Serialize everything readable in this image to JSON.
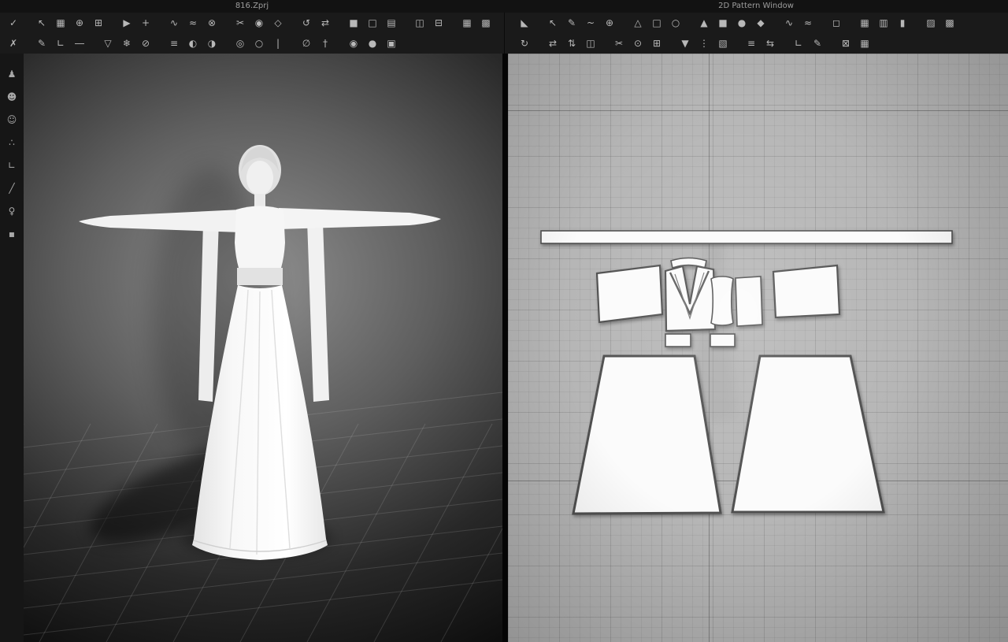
{
  "titlebar": {
    "left_title": "816.Zprj",
    "right_title": "2D Pattern Window"
  },
  "colors": {
    "titlebar_bg": "#121212",
    "toolbar_bg": "#1a1a1a",
    "toolbar_icon": "#b8b8b8",
    "side_toolbar_bg": "#161616",
    "viewport3d_center": "#909090",
    "viewport3d_edge": "#0d0d0d",
    "viewport2d_bg": "#b6b6b6",
    "pattern_fill": "#fbfbfb",
    "pattern_stroke": "#4f4f4f",
    "garment_white": "#f5f5f5",
    "divider": "#050505"
  },
  "toolbar_3d": {
    "row1": [
      {
        "name": "confirm",
        "glyph": "✓"
      },
      {
        "sep": true
      },
      {
        "name": "select-move",
        "glyph": "↖"
      },
      {
        "name": "select-mesh",
        "glyph": "▦"
      },
      {
        "name": "fixed-pin",
        "glyph": "⊕"
      },
      {
        "name": "pin-box",
        "glyph": "⊞"
      },
      {
        "sep": true
      },
      {
        "name": "simulate",
        "glyph": "▶"
      },
      {
        "name": "drag-cloth",
        "glyph": "+"
      },
      {
        "sep": true
      },
      {
        "name": "segment-sew",
        "glyph": "∿"
      },
      {
        "name": "free-sew",
        "glyph": "≈"
      },
      {
        "name": "detach-sew",
        "glyph": "⊗"
      },
      {
        "sep": true
      },
      {
        "name": "scissors",
        "glyph": "✂"
      },
      {
        "name": "tack",
        "glyph": "◉"
      },
      {
        "name": "fold-arrange",
        "glyph": "◇"
      },
      {
        "sep": true
      },
      {
        "name": "reset-pose",
        "glyph": "↺"
      },
      {
        "name": "sync-windows",
        "glyph": "⇄"
      },
      {
        "sep": true
      },
      {
        "name": "solid-view",
        "glyph": "■"
      },
      {
        "name": "wireframe-view",
        "glyph": "□"
      },
      {
        "name": "texture-view",
        "glyph": "▤"
      },
      {
        "sep": true
      },
      {
        "name": "split-horizontal",
        "glyph": "◫"
      },
      {
        "name": "split-vertical",
        "glyph": "⊟"
      },
      {
        "sep": true
      },
      {
        "name": "grid-small",
        "glyph": "▦"
      },
      {
        "name": "grid-large",
        "glyph": "▩"
      }
    ],
    "row2": [
      {
        "name": "cancel",
        "glyph": "✗"
      },
      {
        "sep": true
      },
      {
        "name": "edit-sewing",
        "glyph": "✎"
      },
      {
        "name": "edit-measure",
        "glyph": "∟"
      },
      {
        "name": "tape-measure",
        "glyph": "―"
      },
      {
        "sep": true
      },
      {
        "name": "flatten",
        "glyph": "▽"
      },
      {
        "name": "freeze",
        "glyph": "❄"
      },
      {
        "name": "deactivate",
        "glyph": "⊘"
      },
      {
        "sep": true
      },
      {
        "name": "steam",
        "glyph": "≡"
      },
      {
        "name": "pressure",
        "glyph": "◐"
      },
      {
        "name": "shrink",
        "glyph": "◑"
      },
      {
        "sep": true
      },
      {
        "name": "avatar-tape",
        "glyph": "◎"
      },
      {
        "name": "circumference-tape",
        "glyph": "○"
      },
      {
        "name": "length-tape",
        "glyph": "|"
      },
      {
        "sep": true
      },
      {
        "name": "safety-pin",
        "glyph": "∅"
      },
      {
        "name": "needle",
        "glyph": "†"
      },
      {
        "sep": true
      },
      {
        "name": "camera",
        "glyph": "◉"
      },
      {
        "name": "render",
        "glyph": "●"
      },
      {
        "name": "capture",
        "glyph": "▣"
      }
    ]
  },
  "toolbar_2d": {
    "row1": [
      {
        "name": "show-pattern-tools",
        "glyph": "◣"
      },
      {
        "sep": true
      },
      {
        "name": "transform-pattern",
        "glyph": "↖"
      },
      {
        "name": "edit-pattern",
        "glyph": "✎"
      },
      {
        "name": "edit-curvature",
        "glyph": "~"
      },
      {
        "name": "add-point",
        "glyph": "⊕"
      },
      {
        "sep": true
      },
      {
        "name": "polygon-tool",
        "glyph": "△"
      },
      {
        "name": "rectangle-tool",
        "glyph": "□"
      },
      {
        "name": "circle-tool",
        "glyph": "○"
      },
      {
        "sep": true
      },
      {
        "name": "internal-polygon",
        "glyph": "▲"
      },
      {
        "name": "internal-rectangle",
        "glyph": "■"
      },
      {
        "name": "internal-circle",
        "glyph": "●"
      },
      {
        "name": "dart-tool",
        "glyph": "◆"
      },
      {
        "sep": true
      },
      {
        "name": "segment-sewing-2d",
        "glyph": "∿"
      },
      {
        "name": "free-sewing-2d",
        "glyph": "≈"
      },
      {
        "sep": true
      },
      {
        "name": "seam-allowance",
        "glyph": "◻"
      },
      {
        "sep": true
      },
      {
        "name": "texture-editor",
        "glyph": "▦"
      },
      {
        "name": "grid-view-2d",
        "glyph": "▥"
      },
      {
        "name": "column-view",
        "glyph": "▮"
      },
      {
        "sep": true
      },
      {
        "name": "shade-view",
        "glyph": "▨"
      },
      {
        "name": "pattern-grid",
        "glyph": "▩"
      }
    ],
    "row2": [
      {
        "name": "rotate-pattern",
        "glyph": "↻"
      },
      {
        "sep": true
      },
      {
        "name": "flip-horizontal",
        "glyph": "⇄"
      },
      {
        "name": "flip-vertical",
        "glyph": "⇅"
      },
      {
        "name": "mirror-paste",
        "glyph": "◫"
      },
      {
        "sep": true
      },
      {
        "name": "cut-segment",
        "glyph": "✂"
      },
      {
        "name": "trace-pattern",
        "glyph": "⊙"
      },
      {
        "name": "clone-pattern",
        "glyph": "⊞"
      },
      {
        "sep": true
      },
      {
        "name": "notch-tool",
        "glyph": "▼"
      },
      {
        "name": "pleat-tool",
        "glyph": "⋮"
      },
      {
        "name": "grading-tool",
        "glyph": "▧"
      },
      {
        "sep": true
      },
      {
        "name": "align-tools",
        "glyph": "≡"
      },
      {
        "name": "distribute",
        "glyph": "⇆"
      },
      {
        "sep": true
      },
      {
        "name": "measure-2d",
        "glyph": "∟"
      },
      {
        "name": "annotate",
        "glyph": "✎"
      },
      {
        "sep": true
      },
      {
        "name": "zoom-fit",
        "glyph": "⊠"
      },
      {
        "name": "snap-grid",
        "glyph": "▦"
      }
    ]
  },
  "side_toolbar": [
    {
      "name": "show-garment",
      "glyph": "♟"
    },
    {
      "name": "show-avatar",
      "glyph": "☻"
    },
    {
      "name": "avatar-skin",
      "glyph": "☺"
    },
    {
      "name": "arrangement-points",
      "glyph": "∴"
    },
    {
      "name": "corner-ruler",
      "glyph": "∟"
    },
    {
      "name": "pen-tool",
      "glyph": "╱"
    },
    {
      "name": "mannequin",
      "glyph": "♀"
    },
    {
      "name": "tape",
      "glyph": "▪"
    }
  ]
}
